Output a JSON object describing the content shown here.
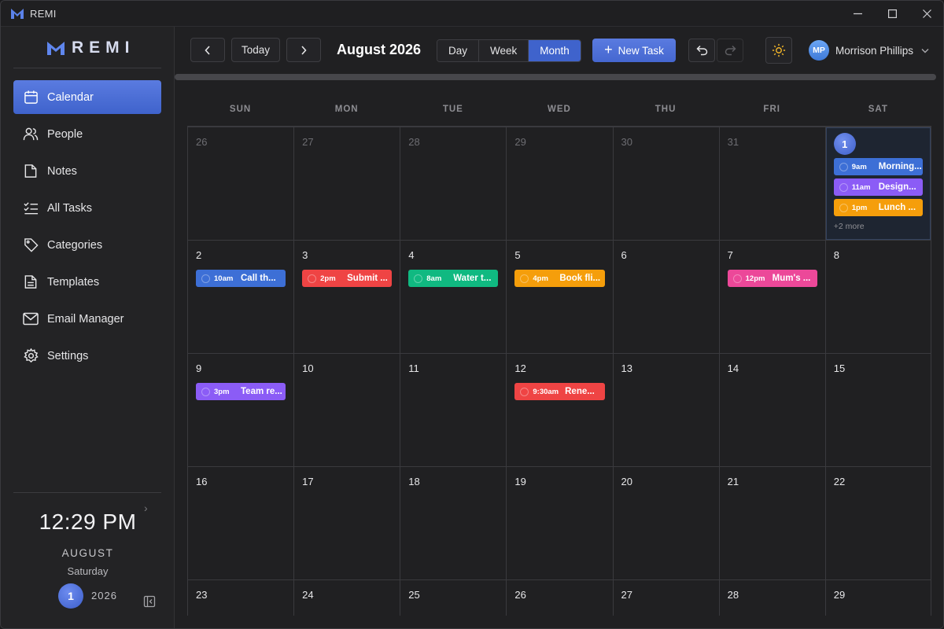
{
  "window": {
    "title": "REMI"
  },
  "brand": {
    "name": "REMI"
  },
  "sidebar": {
    "items": [
      {
        "label": "Calendar",
        "icon": "calendar-icon",
        "active": true
      },
      {
        "label": "People",
        "icon": "people-icon",
        "active": false
      },
      {
        "label": "Notes",
        "icon": "note-icon",
        "active": false
      },
      {
        "label": "All Tasks",
        "icon": "checklist-icon",
        "active": false
      },
      {
        "label": "Categories",
        "icon": "tag-icon",
        "active": false
      },
      {
        "label": "Templates",
        "icon": "document-icon",
        "active": false
      },
      {
        "label": "Email Manager",
        "icon": "mail-icon",
        "active": false
      },
      {
        "label": "Settings",
        "icon": "gear-icon",
        "active": false
      }
    ],
    "clock": {
      "time": "12:29 PM",
      "month": "AUGUST",
      "weekday": "Saturday",
      "day": "1",
      "year": "2026"
    }
  },
  "toolbar": {
    "today_label": "Today",
    "period_title": "August 2026",
    "views": [
      "Day",
      "Week",
      "Month"
    ],
    "active_view": "Month",
    "new_task_label": "New Task",
    "user": {
      "initials": "MP",
      "name": "Morrison Phillips"
    }
  },
  "calendar": {
    "weekdays": [
      "SUN",
      "MON",
      "TUE",
      "WED",
      "THU",
      "FRI",
      "SAT"
    ],
    "more_label": "+2 more"
  },
  "colors": {
    "accent": "#4567d0",
    "blue": "#3d6fd6",
    "purple": "#8b5cf6",
    "amber": "#f59e0b",
    "red": "#ef4444",
    "green": "#10b981",
    "pink": "#ec4899"
  },
  "events": {
    "aug1": [
      {
        "time": "9am",
        "title": "Morning...",
        "color": "#3d6fd6"
      },
      {
        "time": "11am",
        "title": "Design...",
        "color": "#8b5cf6"
      },
      {
        "time": "1pm",
        "title": "Lunch ...",
        "color": "#f59e0b"
      }
    ],
    "aug2": [
      {
        "time": "10am",
        "title": "Call th...",
        "color": "#3d6fd6"
      }
    ],
    "aug3": [
      {
        "time": "2pm",
        "title": "Submit ...",
        "color": "#ef4444"
      }
    ],
    "aug4": [
      {
        "time": "8am",
        "title": "Water t...",
        "color": "#10b981"
      }
    ],
    "aug5": [
      {
        "time": "4pm",
        "title": "Book fli...",
        "color": "#f59e0b"
      }
    ],
    "aug7": [
      {
        "time": "12pm",
        "title": "Mum's ...",
        "color": "#ec4899"
      }
    ],
    "aug9": [
      {
        "time": "3pm",
        "title": "Team re...",
        "color": "#8b5cf6"
      }
    ],
    "aug12": [
      {
        "time": "9:30am",
        "title": "Rene...",
        "color": "#ef4444"
      }
    ]
  },
  "weeks": [
    [
      "26",
      "27",
      "28",
      "29",
      "30",
      "31",
      "1"
    ],
    [
      "2",
      "3",
      "4",
      "5",
      "6",
      "7",
      "8"
    ],
    [
      "9",
      "10",
      "11",
      "12",
      "13",
      "14",
      "15"
    ],
    [
      "16",
      "17",
      "18",
      "19",
      "20",
      "21",
      "22"
    ],
    [
      "23",
      "24",
      "25",
      "26",
      "27",
      "28",
      "29"
    ]
  ]
}
